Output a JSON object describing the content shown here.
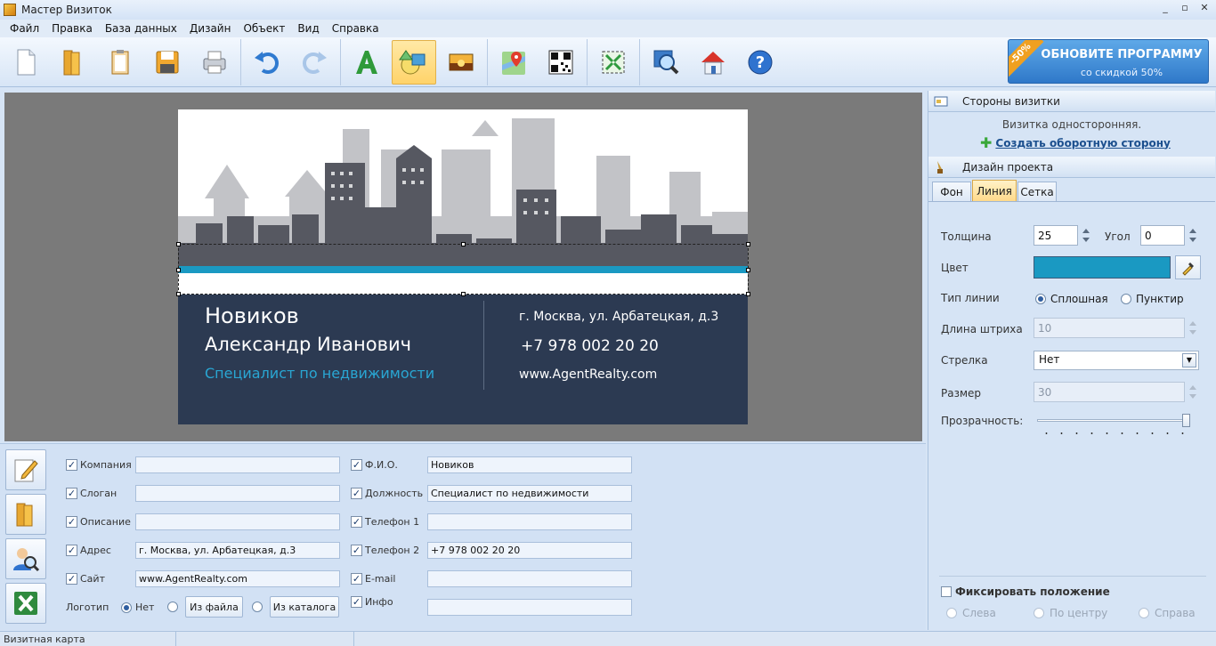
{
  "window": {
    "title": "Мастер Визиток",
    "controls": [
      "_",
      "▫",
      "✕"
    ]
  },
  "menu": [
    "Файл",
    "Правка",
    "База данных",
    "Дизайн",
    "Объект",
    "Вид",
    "Справка"
  ],
  "toolbar": {
    "buttons": [
      "new-file-icon",
      "open-folder-icon",
      "clipboard-icon",
      "save-icon",
      "print-icon",
      "undo-icon",
      "redo-icon",
      "text-icon",
      "shape-icon",
      "image-icon",
      "map-icon",
      "qr-code-icon",
      "fit-to-screen-icon",
      "zoom-icon",
      "home-icon",
      "help-icon"
    ],
    "active": "shape-icon"
  },
  "promo": {
    "badge": "-50%",
    "title": "ОБНОВИТЕ ПРОГРАММУ",
    "subtitle": "со скидкой 50%"
  },
  "card": {
    "surname": "Новиков",
    "name": "Александр Иванович",
    "position": "Специалист по недвижимости",
    "address": "г. Москва, ул. Арбатецкая, д.3",
    "phone": "+7 978 002 20 20",
    "site": "www.AgentRealty.com",
    "stripe_color": "#1a99c2",
    "dark_color": "#2c3a52"
  },
  "form": {
    "left_fields": [
      {
        "label": "Компания",
        "value": ""
      },
      {
        "label": "Слоган",
        "value": ""
      },
      {
        "label": "Описание",
        "value": ""
      },
      {
        "label": "Адрес",
        "value": "г. Москва, ул. Арбатецкая, д.3"
      },
      {
        "label": "Сайт",
        "value": "www.AgentRealty.com"
      }
    ],
    "right_fields": [
      {
        "label": "Ф.И.О.",
        "value": "Новиков"
      },
      {
        "label": "Должность",
        "value": "Специалист по недвижимости"
      },
      {
        "label": "Телефон 1",
        "value": ""
      },
      {
        "label": "Телефон 2",
        "value": "+7 978 002 20 20"
      },
      {
        "label": "E-mail",
        "value": ""
      },
      {
        "label": "Инфо",
        "value": ""
      }
    ],
    "logo_label": "Логотип",
    "logo_none": "Нет",
    "logo_from_file": "Из файла",
    "logo_from_catalog": "Из каталога",
    "checkmark": "✓"
  },
  "right_panel": {
    "sides_header": "Стороны визитки",
    "sides_info": "Визитка односторонняя.",
    "create_back": "Создать оборотную сторону",
    "design_header": "Дизайн проекта",
    "tabs": [
      "Фон",
      "Линия",
      "Сетка"
    ],
    "active_tab": "Линия",
    "thickness_label": "Толщина",
    "thickness": "25",
    "angle_label": "Угол",
    "angle": "0",
    "color_label": "Цвет",
    "color": "#1a99c2",
    "line_type_label": "Тип линии",
    "line_solid": "Сплошная",
    "line_dotted": "Пунктир",
    "dash_length_label": "Длина штриха",
    "dash_length": "10",
    "arrow_label": "Стрелка",
    "arrow": "Нет",
    "size_label": "Размер",
    "size": "30",
    "opacity_label": "Прозрачность:",
    "opacity_level": 1.0,
    "fix_position": "Фиксировать положение",
    "align_left": "Слева",
    "align_center": "По центру",
    "align_right": "Справа"
  },
  "status": {
    "text": "Визитная карта"
  }
}
